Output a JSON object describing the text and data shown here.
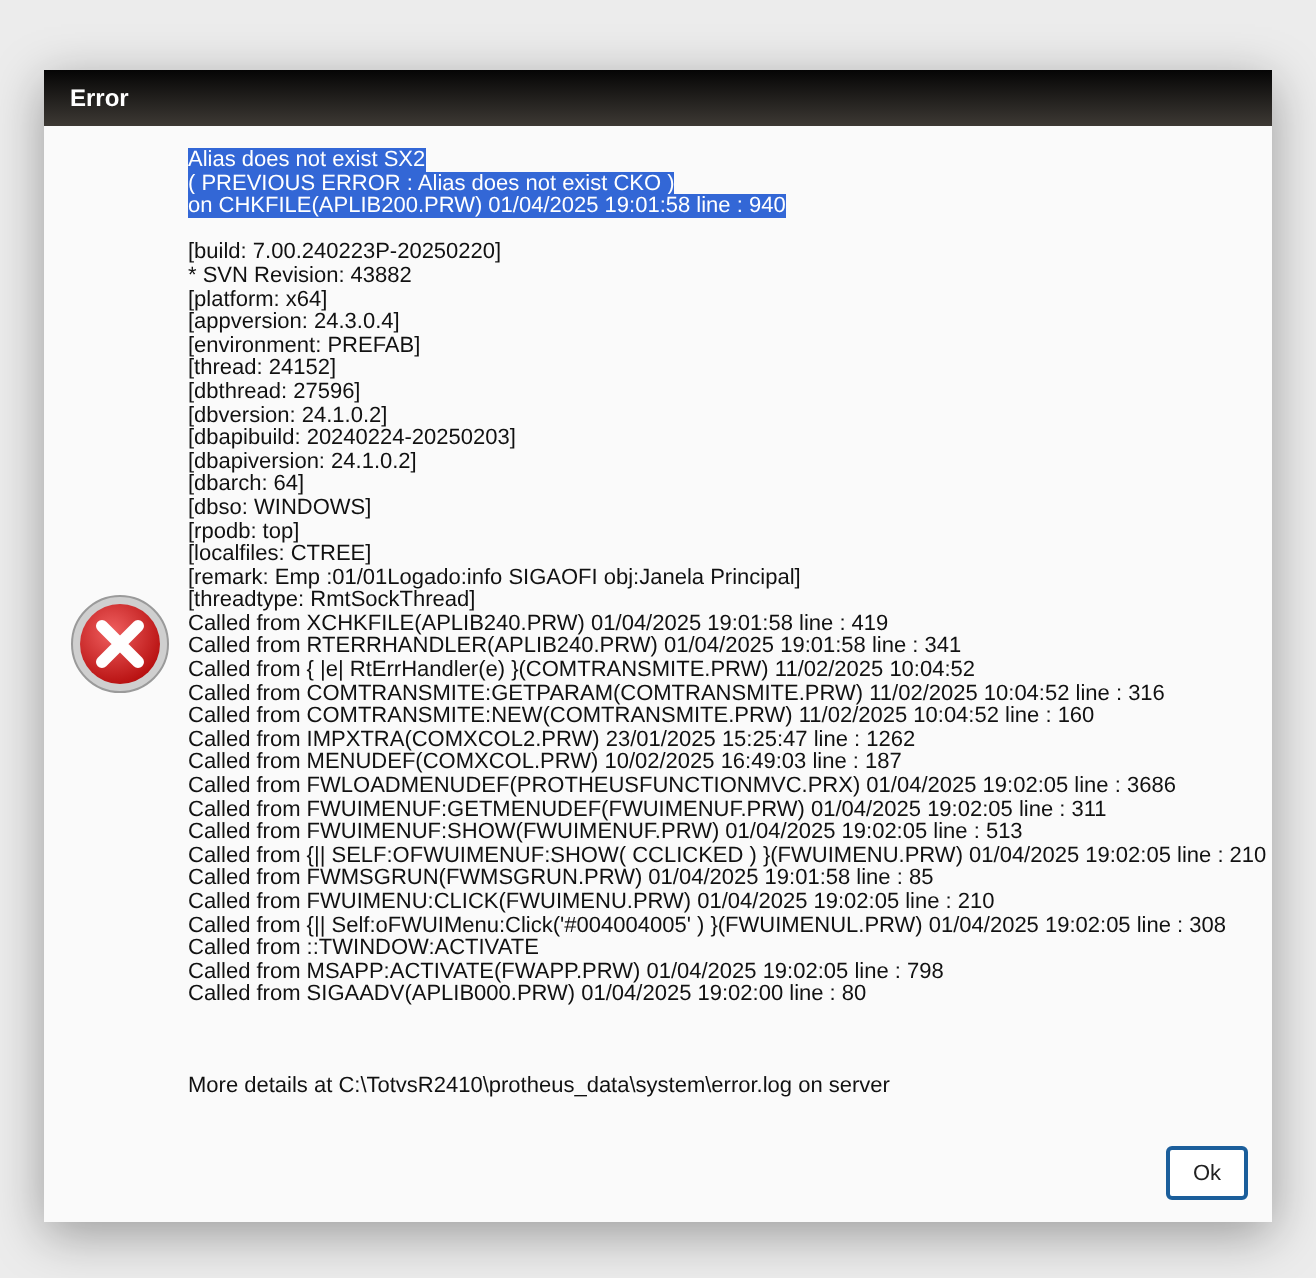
{
  "dialog": {
    "title": "Error",
    "message": {
      "selected": true,
      "lines": [
        "Alias does not exist SX2",
        "( PREVIOUS ERROR : Alias does not exist CKO )",
        "on CHKFILE(APLIB200.PRW) 01/04/2025 19:01:58 line : 940"
      ]
    },
    "details": [
      "[build: 7.00.240223P-20250220]",
      "* SVN Revision: 43882",
      "[platform: x64]",
      "[appversion: 24.3.0.4]",
      "[environment: PREFAB]",
      "[thread: 24152]",
      "[dbthread: 27596]",
      "[dbversion: 24.1.0.2]",
      "[dbapibuild: 20240224-20250203]",
      "[dbapiversion: 24.1.0.2]",
      "[dbarch: 64]",
      "[dbso: WINDOWS]",
      "[rpodb: top]",
      "[localfiles: CTREE]",
      "[remark: Emp :01/01Logado:info SIGAOFI obj:Janela Principal]",
      "[threadtype: RmtSockThread]",
      "Called from XCHKFILE(APLIB240.PRW) 01/04/2025 19:01:58 line : 419",
      "Called from RTERRHANDLER(APLIB240.PRW) 01/04/2025 19:01:58 line : 341",
      "Called from { |e| RtErrHandler(e) }(COMTRANSMITE.PRW) 11/02/2025 10:04:52",
      "Called from COMTRANSMITE:GETPARAM(COMTRANSMITE.PRW) 11/02/2025 10:04:52 line : 316",
      "Called from COMTRANSMITE:NEW(COMTRANSMITE.PRW) 11/02/2025 10:04:52 line : 160",
      "Called from IMPXTRA(COMXCOL2.PRW) 23/01/2025 15:25:47 line : 1262",
      "Called from MENUDEF(COMXCOL.PRW) 10/02/2025 16:49:03 line : 187",
      "Called from FWLOADMENUDEF(PROTHEUSFUNCTIONMVC.PRX) 01/04/2025 19:02:05 line : 3686",
      "Called from FWUIMENUF:GETMENUDEF(FWUIMENUF.PRW) 01/04/2025 19:02:05 line : 311",
      "Called from FWUIMENUF:SHOW(FWUIMENUF.PRW) 01/04/2025 19:02:05 line : 513",
      "Called from {|| SELF:OFWUIMENUF:SHOW( CCLICKED ) }(FWUIMENU.PRW) 01/04/2025 19:02:05 line : 210",
      "Called from FWMSGRUN(FWMSGRUN.PRW) 01/04/2025 19:01:58 line : 85",
      "Called from FWUIMENU:CLICK(FWUIMENU.PRW) 01/04/2025 19:02:05 line : 210",
      "Called from {|| Self:oFWUIMenu:Click('#004004005' ) }(FWUIMENUL.PRW) 01/04/2025 19:02:05 line : 308",
      "Called from ::TWINDOW:ACTIVATE",
      "Called from MSAPP:ACTIVATE(FWAPP.PRW) 01/04/2025 19:02:05 line : 798",
      "Called from SIGAADV(APLIB000.PRW) 01/04/2025 19:02:00 line : 80"
    ],
    "footer": "More details at C:\\TotvsR2410\\protheus_data\\system\\error.log on server",
    "button": "Ok"
  }
}
